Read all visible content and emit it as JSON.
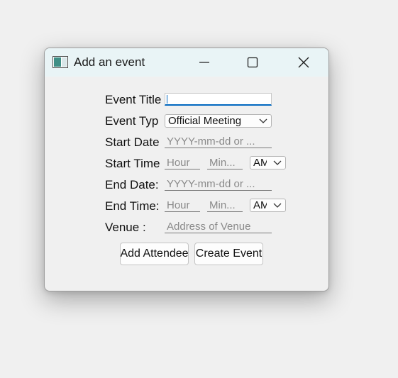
{
  "window": {
    "title": "Add an event"
  },
  "form": {
    "event_title_label": "Event Title",
    "event_title_value": "",
    "event_type_label": "Event Typ",
    "event_type_selected": "Official Meeting",
    "start_date_label": "Start Date",
    "start_date_placeholder": "YYYY-mm-dd or ...",
    "start_time_label": "Start Time",
    "start_hour_placeholder": "Hour",
    "start_minute_placeholder": "Min...",
    "start_ampm_selected": "AM",
    "end_date_label": "End Date:",
    "end_date_placeholder": "YYYY-mm-dd or ...",
    "end_time_label": "End Time:",
    "end_hour_placeholder": "Hour",
    "end_minute_placeholder": "Min...",
    "end_ampm_selected": "AM",
    "venue_label": "Venue :",
    "venue_placeholder": "Address of Venue"
  },
  "buttons": {
    "add_attendee": "Add Attendee",
    "create_event": "Create Event"
  },
  "icons": {
    "app": "window-app-icon",
    "minimize": "minimize-icon",
    "maximize": "maximize-icon",
    "close": "close-icon",
    "dropdown": "chevron-down-icon"
  },
  "colors": {
    "titlebar": "#e9f4f6",
    "window_bg": "#f0f0f0",
    "focus_accent": "#0067c0"
  }
}
